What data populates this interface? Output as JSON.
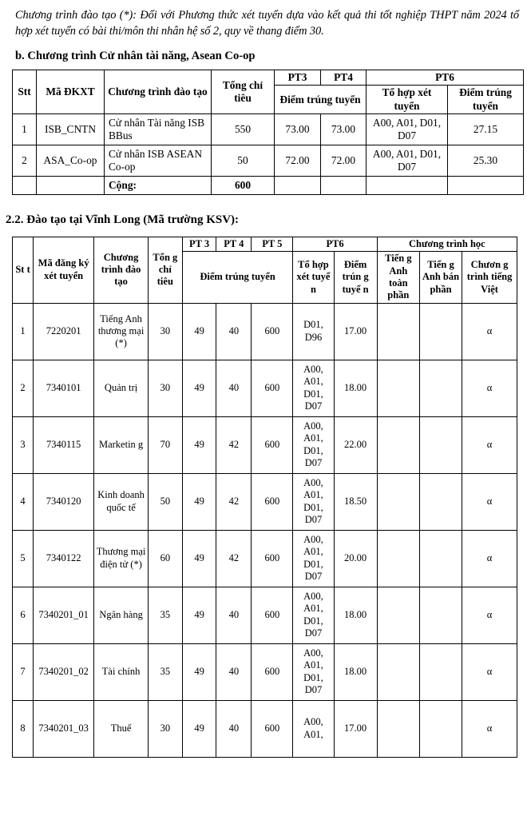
{
  "intro_note": "Chương trình đào tạo (*): Đối với Phương thức xét tuyển dựa vào kết quả thi tốt nghiệp THPT năm 2024 tổ hợp xét tuyển có bài thi/môn thi nhân hệ số 2, quy về thang điểm 30.",
  "section_b": {
    "heading": "b. Chương trình Cử nhân tài năng, Asean Co-op",
    "table": {
      "header_top": {
        "stt": "Stt",
        "ma_dkxt": "Mã ĐKXT",
        "chuong_trinh": "Chương trình đào tạo",
        "tong_chi_tieu": "Tổng chỉ tiêu",
        "pt3": "PT3",
        "pt4": "PT4",
        "pt6": "PT6"
      },
      "header_sub": {
        "diem_trung_tuyen": "Điểm trúng tuyển",
        "to_hop_xet_tuyen": "Tổ hợp xét tuyển",
        "diem_trung_tuyen_2": "Điểm trúng tuyển"
      },
      "rows": [
        {
          "stt": "1",
          "ma_dkxt": "ISB_CNTN",
          "chuong_trinh": "Cử nhân Tài năng ISB BBus",
          "tong_chi_tieu": "550",
          "pt3": "73.00",
          "pt4": "73.00",
          "pt6_tohop": "A00, A01, D01, D07",
          "pt6_diem": "27.15"
        },
        {
          "stt": "2",
          "ma_dkxt": "ASA_Co-op",
          "chuong_trinh": "Cử nhân ISB ASEAN Co-op",
          "tong_chi_tieu": "50",
          "pt3": "72.00",
          "pt4": "72.00",
          "pt6_tohop": "A00, A01, D01, D07",
          "pt6_diem": "25.30"
        }
      ],
      "total_row": {
        "label": "Cộng:",
        "value": "600"
      }
    }
  },
  "section_2_2": {
    "heading": "2.2. Đào tạo tại Vĩnh Long (Mã trường KSV):",
    "table": {
      "header_top": {
        "stt": "St t",
        "ma_dang_ky": "Mã đăng ký xét tuyển",
        "chuong_trinh": "Chương trình đào tạo",
        "tong_chi_tieu": "Tổn g chỉ tiêu",
        "pt3": "PT 3",
        "pt4": "PT 4",
        "pt5": "PT 5",
        "pt6": "PT6",
        "chuong_trinh_hoc": "Chương trình học"
      },
      "header_sub": {
        "diem_trung_tuyen": "Điểm trúng tuyển",
        "pt6_tohop": "Tổ hợp xét tuyể n",
        "pt6_diem": "Điểm trún g tuyể n",
        "ta_toan_phan": "Tiến g Anh toàn phần",
        "ta_ban_phan": "Tiến g Anh bán phần",
        "ct_tieng_viet": "Chươn g trình tiếng Việt"
      },
      "rows": [
        {
          "stt": "1",
          "ma": "7220201",
          "chuong_trinh": "Tiếng Anh thương mại (*)",
          "tong_chi_tieu": "30",
          "pt3": "49",
          "pt4": "40",
          "pt5": "600",
          "pt6_tohop": "D01, D96",
          "pt6_diem": "17.00",
          "ta_toan_phan": "",
          "ta_ban_phan": "",
          "ct_tieng_viet": "α"
        },
        {
          "stt": "2",
          "ma": "7340101",
          "chuong_trinh": "Quản trị",
          "tong_chi_tieu": "30",
          "pt3": "49",
          "pt4": "40",
          "pt5": "600",
          "pt6_tohop": "A00, A01, D01, D07",
          "pt6_diem": "18.00",
          "ta_toan_phan": "",
          "ta_ban_phan": "",
          "ct_tieng_viet": "α"
        },
        {
          "stt": "3",
          "ma": "7340115",
          "chuong_trinh": "Marketin g",
          "tong_chi_tieu": "70",
          "pt3": "49",
          "pt4": "42",
          "pt5": "600",
          "pt6_tohop": "A00, A01, D01, D07",
          "pt6_diem": "22.00",
          "ta_toan_phan": "",
          "ta_ban_phan": "",
          "ct_tieng_viet": "α"
        },
        {
          "stt": "4",
          "ma": "7340120",
          "chuong_trinh": "Kinh doanh quốc tế",
          "tong_chi_tieu": "50",
          "pt3": "49",
          "pt4": "42",
          "pt5": "600",
          "pt6_tohop": "A00, A01, D01, D07",
          "pt6_diem": "18.50",
          "ta_toan_phan": "",
          "ta_ban_phan": "",
          "ct_tieng_viet": "α"
        },
        {
          "stt": "5",
          "ma": "7340122",
          "chuong_trinh": "Thương mại điện tử (*)",
          "tong_chi_tieu": "60",
          "pt3": "49",
          "pt4": "42",
          "pt5": "600",
          "pt6_tohop": "A00, A01, D01, D07",
          "pt6_diem": "20.00",
          "ta_toan_phan": "",
          "ta_ban_phan": "",
          "ct_tieng_viet": "α"
        },
        {
          "stt": "6",
          "ma": "7340201_01",
          "chuong_trinh": "Ngân hàng",
          "tong_chi_tieu": "35",
          "pt3": "49",
          "pt4": "40",
          "pt5": "600",
          "pt6_tohop": "A00, A01, D01, D07",
          "pt6_diem": "18.00",
          "ta_toan_phan": "",
          "ta_ban_phan": "",
          "ct_tieng_viet": "α"
        },
        {
          "stt": "7",
          "ma": "7340201_02",
          "chuong_trinh": "Tài chính",
          "tong_chi_tieu": "35",
          "pt3": "49",
          "pt4": "40",
          "pt5": "600",
          "pt6_tohop": "A00, A01, D01, D07",
          "pt6_diem": "18.00",
          "ta_toan_phan": "",
          "ta_ban_phan": "",
          "ct_tieng_viet": "α"
        },
        {
          "stt": "8",
          "ma": "7340201_03",
          "chuong_trinh": "Thuế",
          "tong_chi_tieu": "30",
          "pt3": "49",
          "pt4": "40",
          "pt5": "600",
          "pt6_tohop": "A00, A01,",
          "pt6_diem": "17.00",
          "ta_toan_phan": "",
          "ta_ban_phan": "",
          "ct_tieng_viet": "α"
        }
      ]
    }
  }
}
